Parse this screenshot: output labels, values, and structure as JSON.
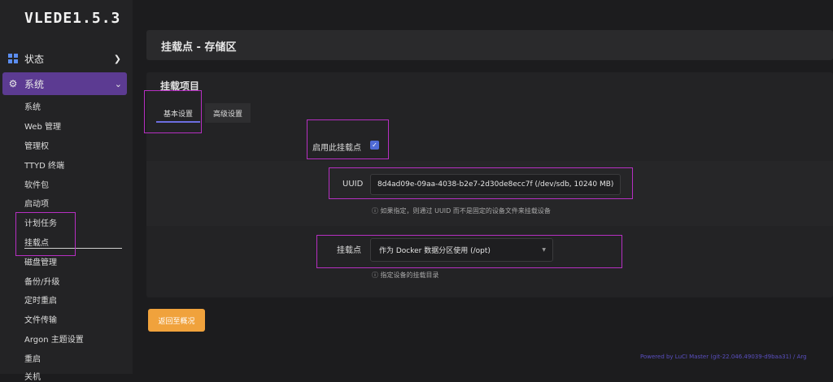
{
  "logo": "VLEDE1.5.3",
  "menu": {
    "status_label": "状态",
    "system_label": "系统",
    "submenu": [
      "系统",
      "Web 管理",
      "管理权",
      "TTYD 终端",
      "软件包",
      "启动项",
      "计划任务",
      "挂载点",
      "磁盘管理",
      "备份/升级",
      "定时重启",
      "文件传输",
      "Argon 主题设置",
      "重启",
      "关机"
    ]
  },
  "page": {
    "title": "挂载点 - 存储区",
    "section_title": "挂载项目",
    "tabs": [
      "基本设置",
      "高级设置"
    ],
    "enable_label": "启用此挂载点",
    "enable_checked": true,
    "uuid_label": "UUID",
    "uuid_value": "8d4ad09e-09aa-4038-b2e7-2d30de8ecc7f (/dev/sdb, 10240 MB)",
    "uuid_hint": "如果指定，则通过 UUID 而不是固定的设备文件来挂载设备",
    "mount_label": "挂载点",
    "mount_value": "作为 Docker 数据分区使用 (/opt)",
    "mount_hint": "指定设备的挂载目录",
    "back_button": "返回至概况"
  },
  "footer": "Powered by LuCI Master (git-22.046.49039-d9baa31) / Arg",
  "colors": {
    "accent": "#5c3b92",
    "button": "#f0a23c",
    "highlight": "#b62fc2"
  }
}
